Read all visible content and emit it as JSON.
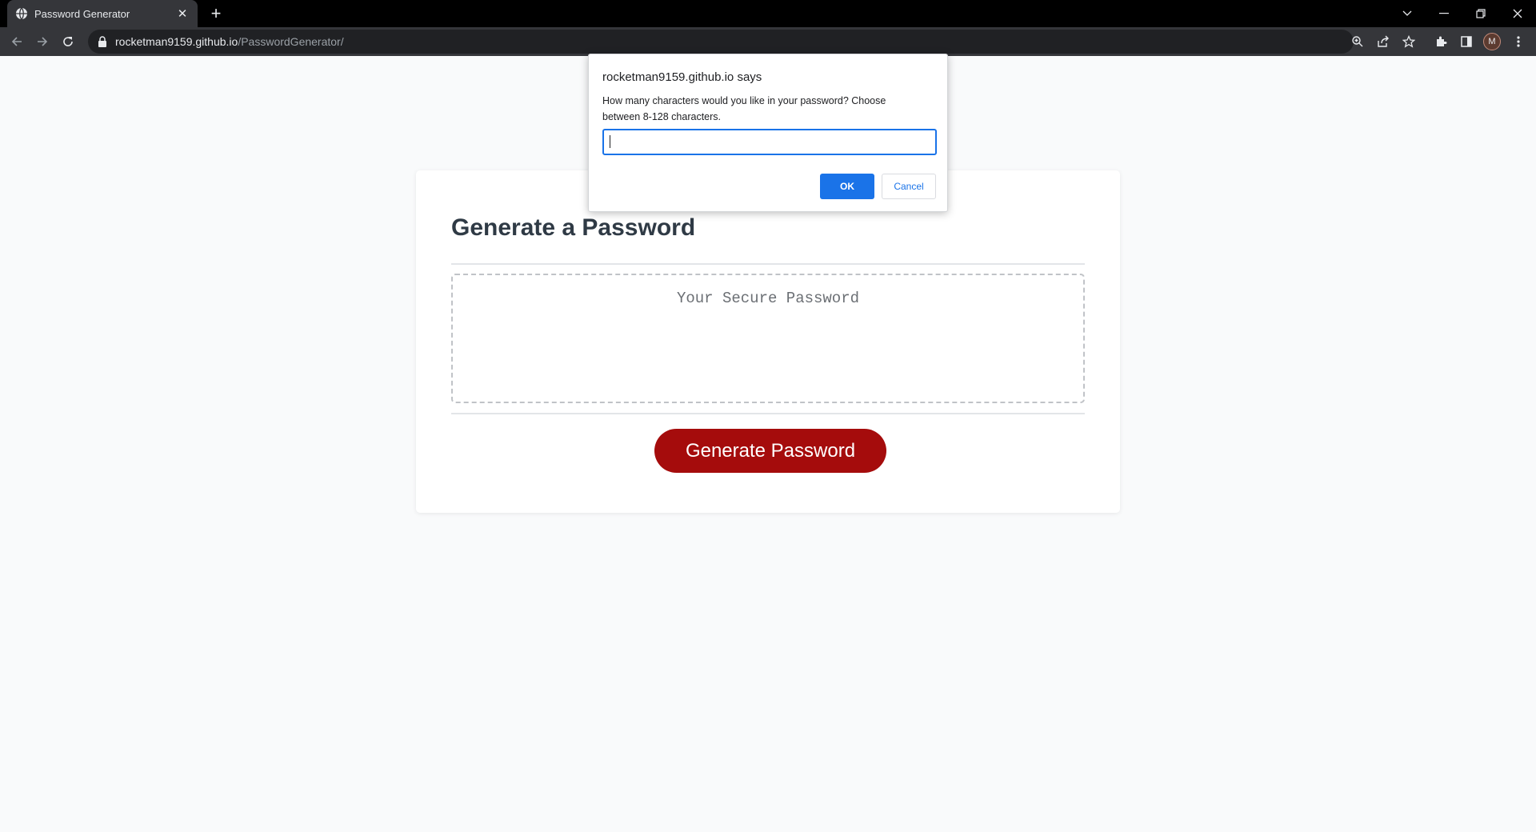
{
  "browser": {
    "tab_title": "Password Generator",
    "tab_close": "✕",
    "new_tab": "+",
    "url_host": "rocketman9159.github.io",
    "url_path": "/PasswordGenerator/",
    "profile_initial": "M"
  },
  "page": {
    "heading": "Generate a Password",
    "password_placeholder": "Your Secure Password",
    "generate_button": "Generate Password",
    "accent_color": "#a50c0c"
  },
  "dialog": {
    "title": "rocketman9159.github.io says",
    "message": "How many characters would you like in your password? Choose between 8-128 characters.",
    "input_value": "",
    "ok_label": "OK",
    "cancel_label": "Cancel"
  }
}
